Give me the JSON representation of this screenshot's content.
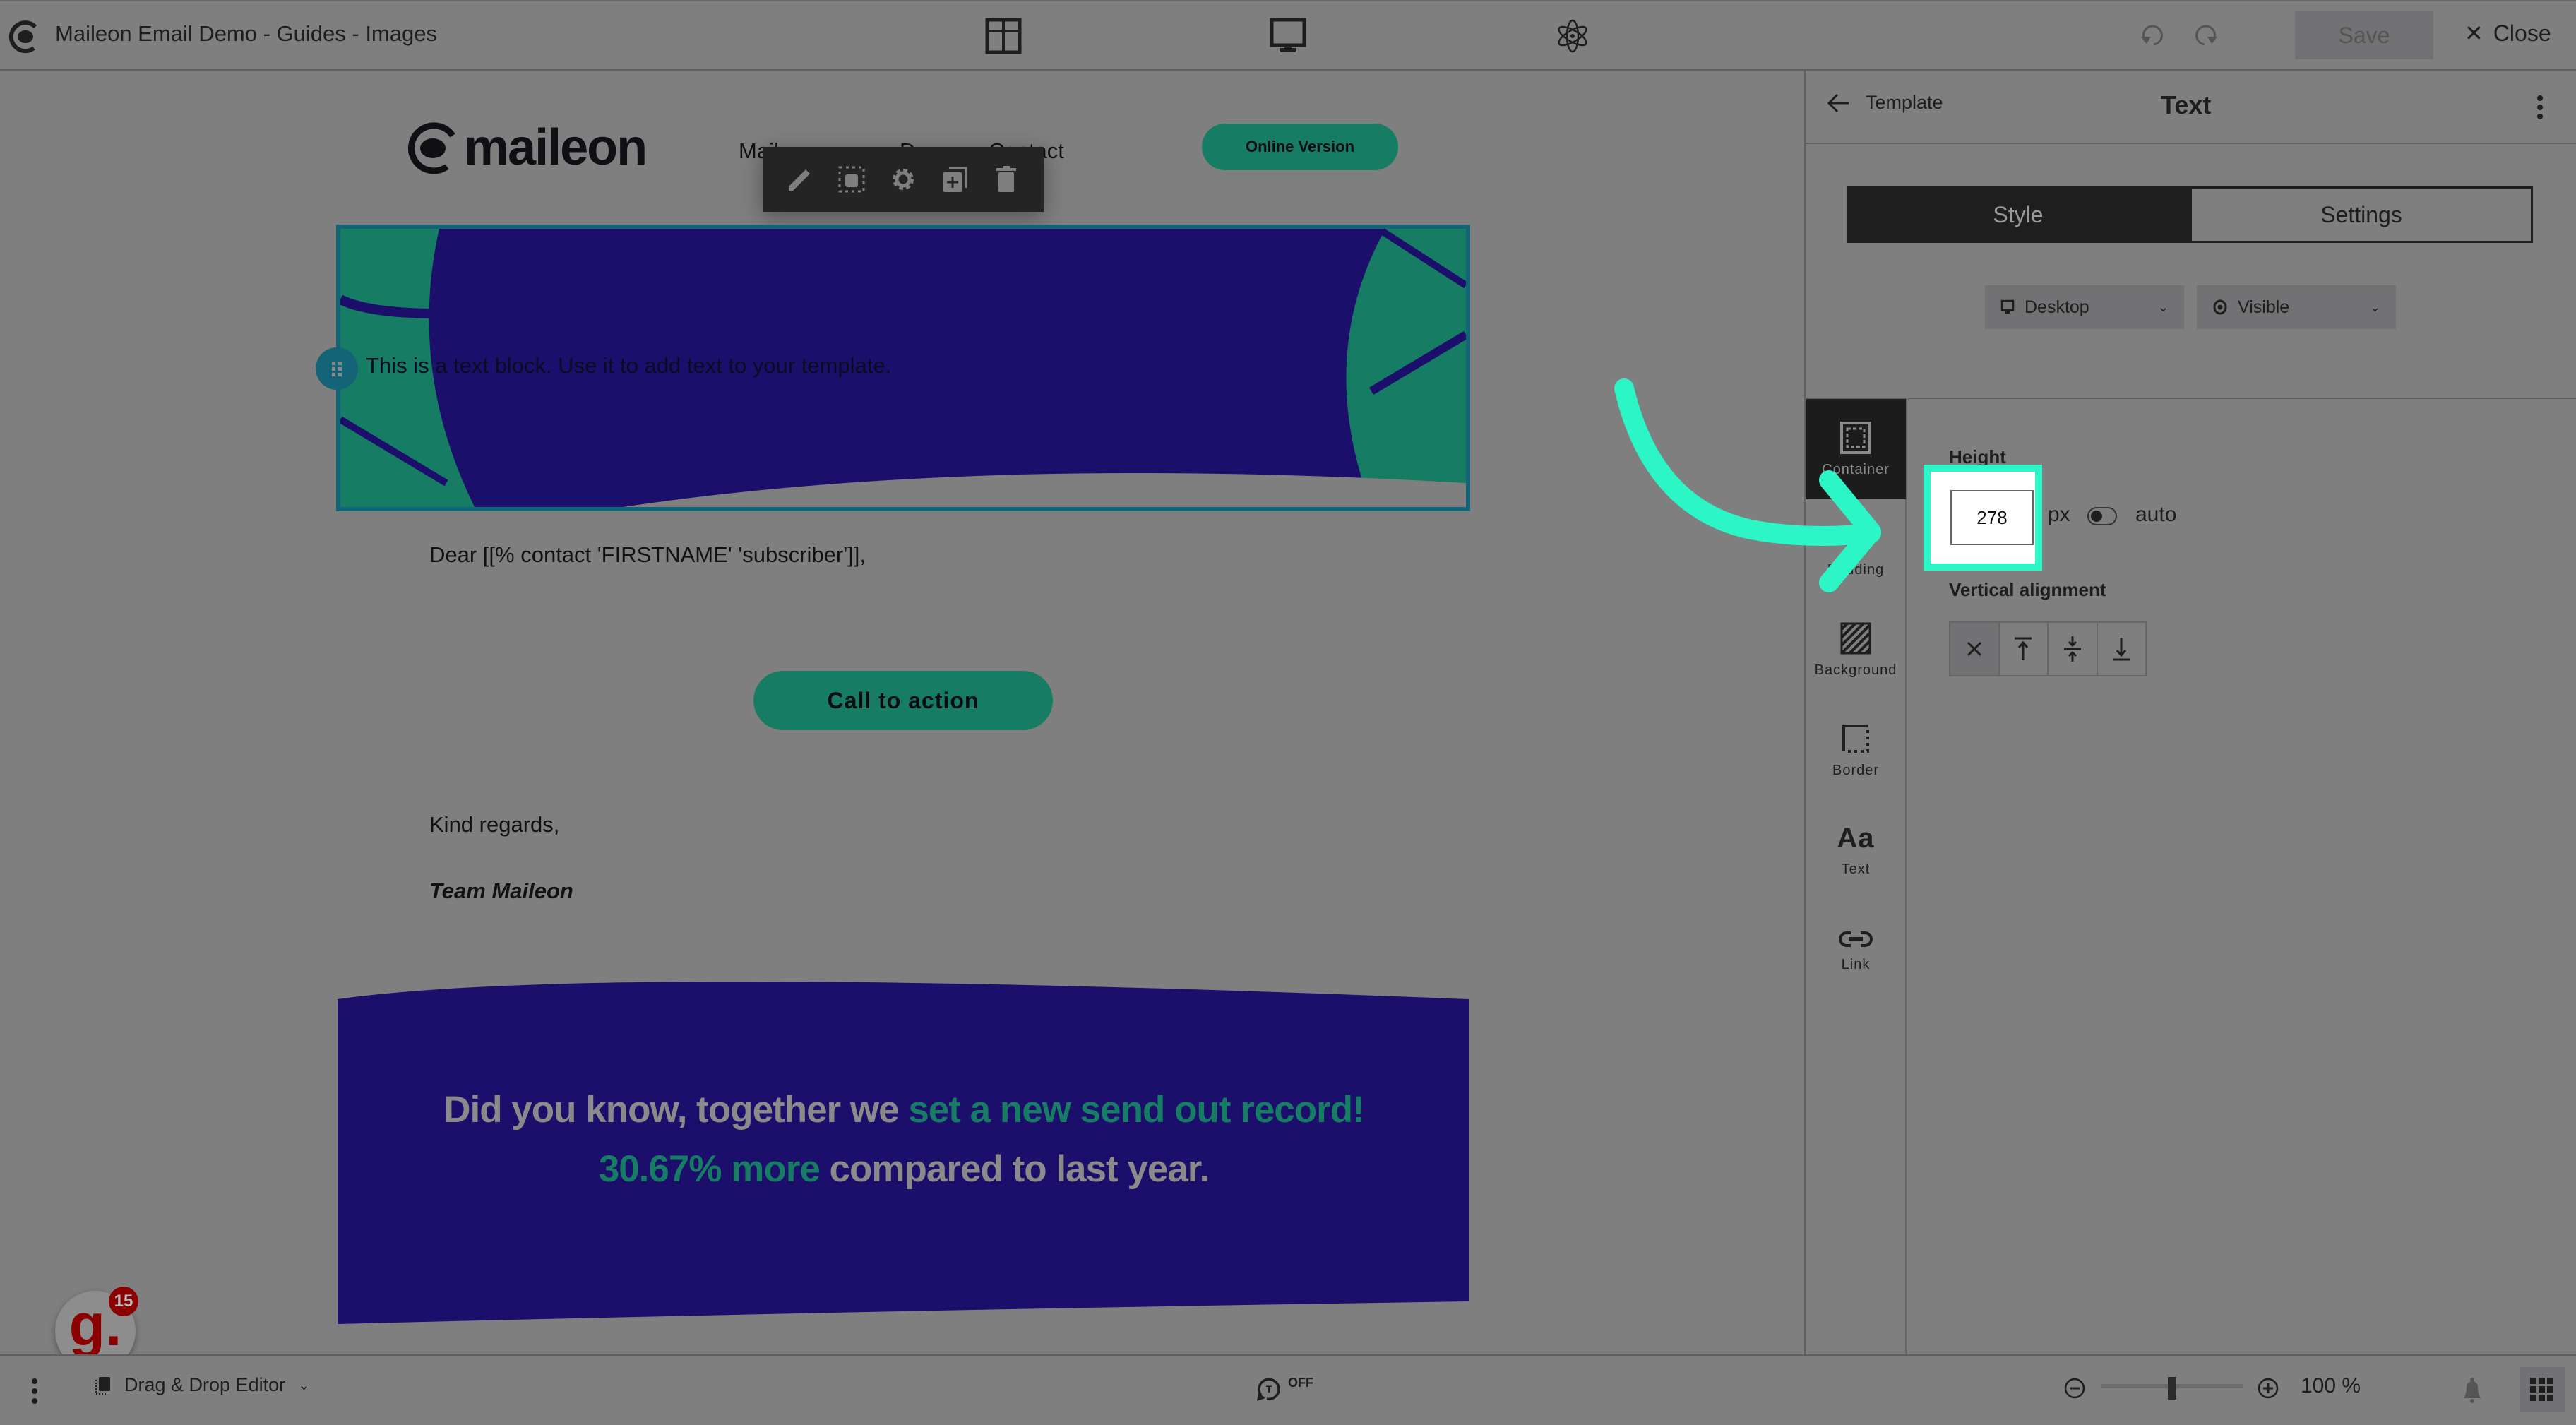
{
  "app": {
    "title": "Maileon Email Demo - Guides - Images",
    "logo_icon": "maileon-chameleon-at-icon"
  },
  "topbar": {
    "icons": [
      "layout-grid-icon",
      "desktop-preview-icon",
      "atom-icon"
    ],
    "undo_icon": "undo-icon",
    "redo_icon": "redo-icon",
    "save_label": "Save",
    "close_label": "Close"
  },
  "email": {
    "logo_text": "maileon",
    "nav_links": [
      "Mail",
      "D",
      "Contact"
    ],
    "online_version_label": "Online Version",
    "block_toolbar": [
      "edit-icon",
      "select-parent-icon",
      "settings-icon",
      "duplicate-icon",
      "delete-icon"
    ],
    "hero_text": "This is a text block. Use it to add text to your template.",
    "greeting": "Dear [[% contact 'FIRSTNAME' 'subscriber']],",
    "cta_label": "Call to action",
    "regards": "Kind regards,",
    "signature": "Team Maileon",
    "promo": {
      "part1": "Did you know, together we ",
      "highlight1": "set a new send out record! 30.67% more",
      "part2": " compared to last year."
    },
    "colors": {
      "brand_green": "#167c64",
      "hero_navy": "#1c0f6b",
      "selection_teal": "#146478"
    }
  },
  "guide_widget": {
    "letter": "g.",
    "count": "15"
  },
  "panel": {
    "back_label": "Template",
    "title": "Text",
    "tabs": [
      {
        "label": "Style",
        "active": true
      },
      {
        "label": "Settings",
        "active": false
      }
    ],
    "device_select": {
      "value": "Desktop",
      "icon": "desktop-icon"
    },
    "visibility_select": {
      "value": "Visible",
      "icon": "eye-icon"
    },
    "rail": [
      {
        "label": "Container",
        "icon": "container-icon",
        "active": true
      },
      {
        "label": "Padding",
        "icon": "padding-icon",
        "active": false
      },
      {
        "label": "Background",
        "icon": "background-icon",
        "active": false
      },
      {
        "label": "Border",
        "icon": "border-icon",
        "active": false
      },
      {
        "label": "Text",
        "icon": "text-aa-icon",
        "active": false
      },
      {
        "label": "Link",
        "icon": "link-icon",
        "active": false
      }
    ],
    "height": {
      "label": "Height",
      "value": "278",
      "unit": "px",
      "auto_label": "auto",
      "auto_enabled": false
    },
    "vertical_alignment": {
      "label": "Vertical alignment",
      "options": [
        "none",
        "top",
        "middle",
        "bottom"
      ],
      "selected": "none"
    }
  },
  "annotation": {
    "arrow_color": "#2cf5c6",
    "target": "height-input"
  },
  "bottombar": {
    "editor_mode": "Drag & Drop Editor",
    "autosave_label": "OFF",
    "zoom_value": "100 %",
    "zoom_fraction": 0.5
  }
}
